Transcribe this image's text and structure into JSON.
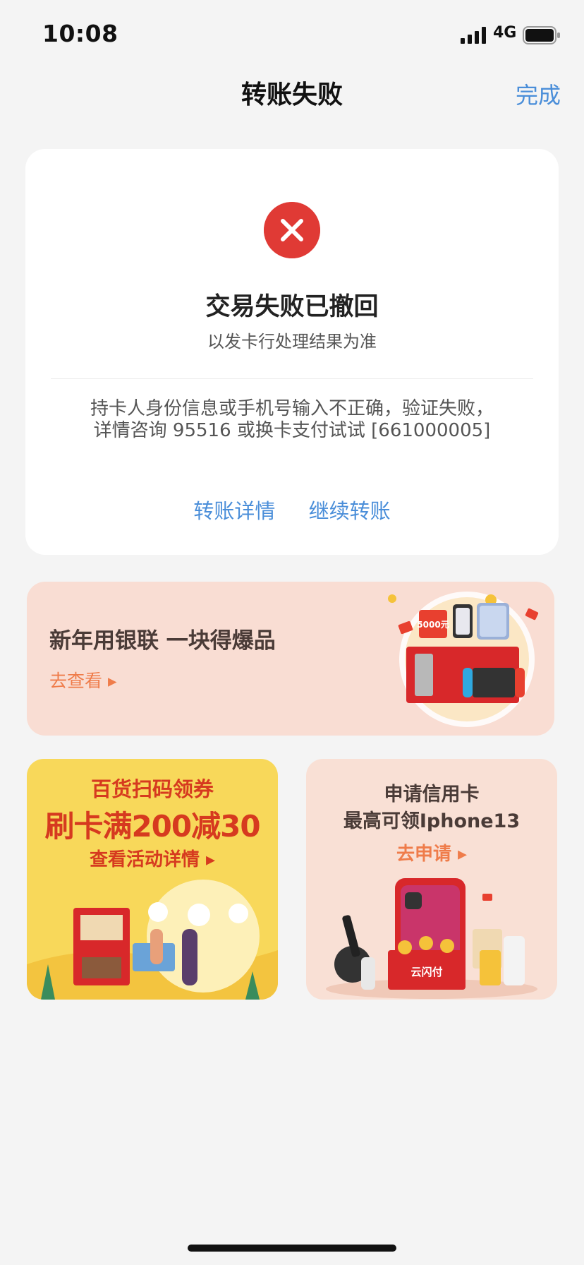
{
  "status_bar": {
    "time": "10:08",
    "network": "4G"
  },
  "nav": {
    "title": "转账失败",
    "done_label": "完成"
  },
  "result": {
    "icon": "close-icon",
    "status_color": "#e03a35",
    "title": "交易失败已撤回",
    "subtitle": "以发卡行处理结果为准",
    "message": "持卡人身份信息或手机号输入不正确，验证失败，详情咨询 95516 或换卡支付试试 [661000005]",
    "actions": {
      "details_label": "转账详情",
      "continue_label": "继续转账"
    }
  },
  "promo_banner": {
    "title": "新年用银联 一块得爆品",
    "link": "去查看 ▸",
    "art_label": "5000元"
  },
  "tiles": {
    "left": {
      "line1": "百货扫码领券",
      "line2": "刷卡满200减30",
      "line3": "查看活动详情 ▸"
    },
    "right": {
      "line1": "申请信用卡",
      "line2": "最高可领Iphone13",
      "line3": "去申请 ▸",
      "box_label": "云闪付"
    }
  },
  "colors": {
    "accent": "#4a8ed9",
    "error": "#e03a35",
    "promo_orange": "#ef7c4a",
    "promo_red": "#d63a1f"
  }
}
